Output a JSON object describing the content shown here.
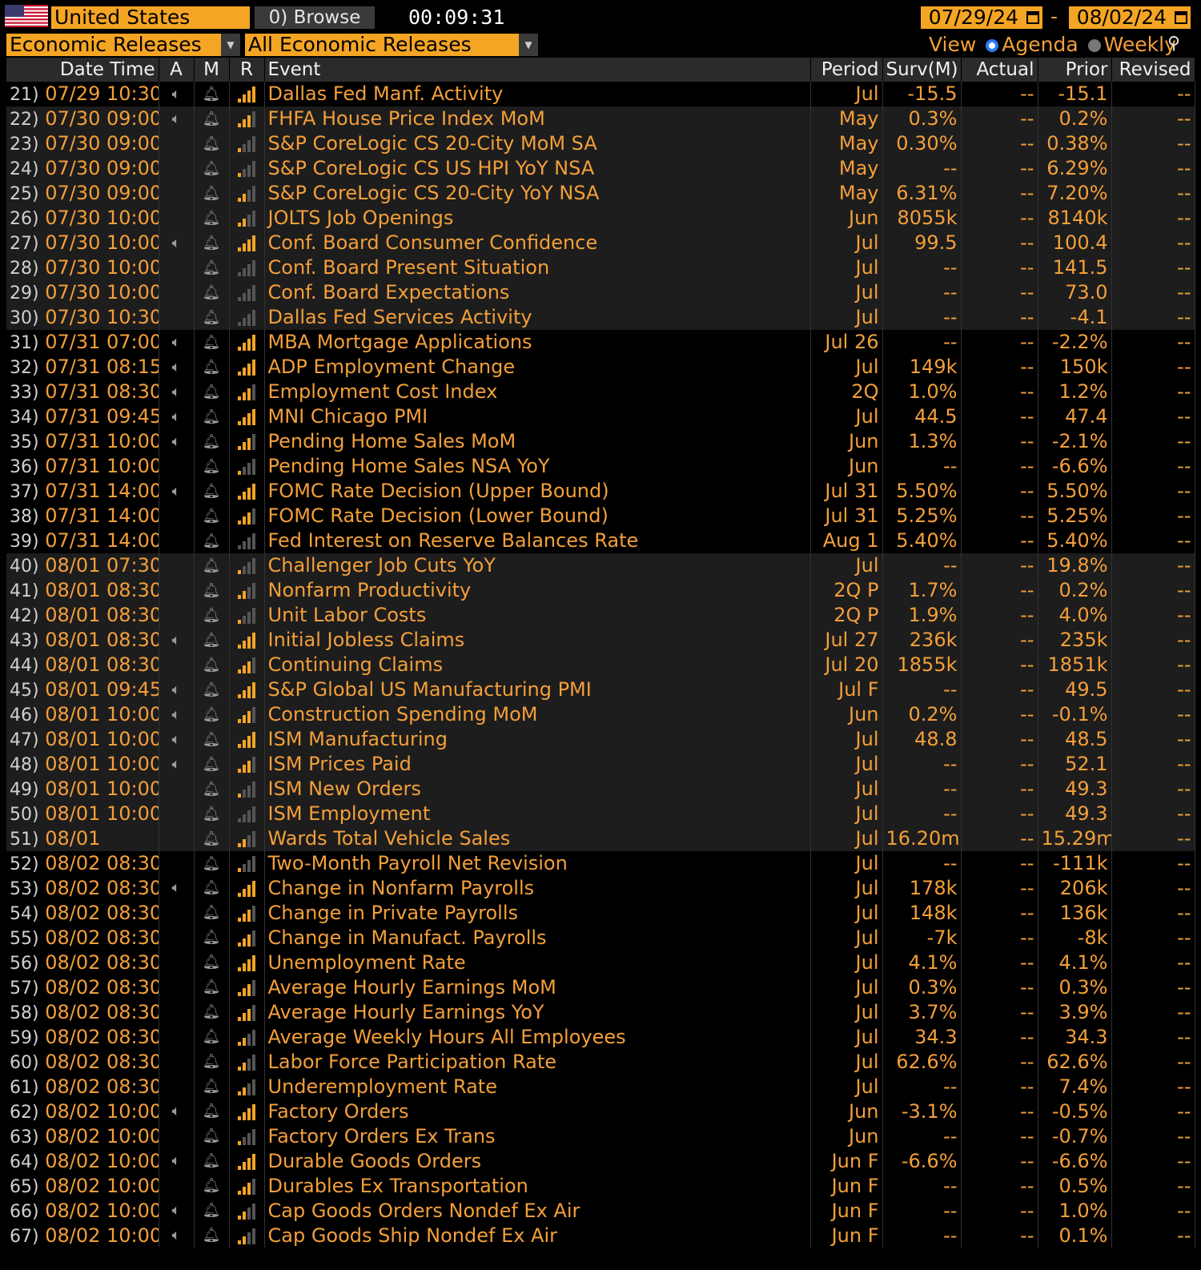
{
  "header": {
    "country": "United States",
    "browse_label": "Browse",
    "browse_prefix": "0",
    "clock": "00:09:31",
    "date_from": "07/29/24",
    "date_to": "08/02/24",
    "date_sep": "-",
    "filter1": "Economic Releases",
    "filter2": "All Economic Releases",
    "view_label": "View",
    "view_option1": "Agenda",
    "view_option2": "Weekly"
  },
  "columns": [
    "Date Time",
    "A",
    "M",
    "R",
    "Event",
    "Period",
    "Surv(M)",
    "Actual",
    "Prior",
    "Revised"
  ],
  "rows": [
    {
      "n": "21)",
      "dt": "07/29 10:30",
      "a": 1,
      "r": 4,
      "event": "Dallas Fed Manf. Activity",
      "period": "Jul",
      "surv": "-15.5",
      "actual": "--",
      "prior": "-15.1",
      "revised": "--",
      "shade": "blk"
    },
    {
      "n": "22)",
      "dt": "07/30 09:00",
      "a": 1,
      "r": 3,
      "event": "FHFA House Price Index MoM",
      "period": "May",
      "surv": "0.3%",
      "actual": "--",
      "prior": "0.2%",
      "revised": "--",
      "shade": "alt"
    },
    {
      "n": "23)",
      "dt": "07/30 09:00",
      "a": 0,
      "r": 1,
      "event": "S&P CoreLogic CS 20-City MoM SA",
      "period": "May",
      "surv": "0.30%",
      "actual": "--",
      "prior": "0.38%",
      "revised": "--",
      "shade": "alt"
    },
    {
      "n": "24)",
      "dt": "07/30 09:00",
      "a": 0,
      "r": 1,
      "event": "S&P CoreLogic CS US HPI YoY NSA",
      "period": "May",
      "surv": "--",
      "actual": "--",
      "prior": "6.29%",
      "revised": "--",
      "shade": "alt"
    },
    {
      "n": "25)",
      "dt": "07/30 09:00",
      "a": 0,
      "r": 2,
      "event": "S&P CoreLogic CS 20-City YoY NSA",
      "period": "May",
      "surv": "6.31%",
      "actual": "--",
      "prior": "7.20%",
      "revised": "--",
      "shade": "alt"
    },
    {
      "n": "26)",
      "dt": "07/30 10:00",
      "a": 0,
      "r": 2,
      "event": "JOLTS Job Openings",
      "period": "Jun",
      "surv": "8055k",
      "actual": "--",
      "prior": "8140k",
      "revised": "--",
      "shade": "alt"
    },
    {
      "n": "27)",
      "dt": "07/30 10:00",
      "a": 1,
      "r": 4,
      "event": "Conf. Board Consumer Confidence",
      "period": "Jul",
      "surv": "99.5",
      "actual": "--",
      "prior": "100.4",
      "revised": "--",
      "shade": "alt"
    },
    {
      "n": "28)",
      "dt": "07/30 10:00",
      "a": 0,
      "r": 0,
      "event": "Conf. Board Present Situation",
      "period": "Jul",
      "surv": "--",
      "actual": "--",
      "prior": "141.5",
      "revised": "--",
      "shade": "alt"
    },
    {
      "n": "29)",
      "dt": "07/30 10:00",
      "a": 0,
      "r": 0,
      "event": "Conf. Board Expectations",
      "period": "Jul",
      "surv": "--",
      "actual": "--",
      "prior": "73.0",
      "revised": "--",
      "shade": "alt"
    },
    {
      "n": "30)",
      "dt": "07/30 10:30",
      "a": 0,
      "r": 0,
      "event": "Dallas Fed Services Activity",
      "period": "Jul",
      "surv": "--",
      "actual": "--",
      "prior": "-4.1",
      "revised": "--",
      "shade": "alt"
    },
    {
      "n": "31)",
      "dt": "07/31 07:00",
      "a": 1,
      "r": 4,
      "event": "MBA Mortgage Applications",
      "period": "Jul 26",
      "surv": "--",
      "actual": "--",
      "prior": "-2.2%",
      "revised": "--",
      "shade": "blk"
    },
    {
      "n": "32)",
      "dt": "07/31 08:15",
      "a": 1,
      "r": 4,
      "event": "ADP Employment Change",
      "period": "Jul",
      "surv": "149k",
      "actual": "--",
      "prior": "150k",
      "revised": "--",
      "shade": "blk"
    },
    {
      "n": "33)",
      "dt": "07/31 08:30",
      "a": 1,
      "r": 3,
      "event": "Employment Cost Index",
      "period": "2Q",
      "surv": "1.0%",
      "actual": "--",
      "prior": "1.2%",
      "revised": "--",
      "shade": "blk"
    },
    {
      "n": "34)",
      "dt": "07/31 09:45",
      "a": 1,
      "r": 4,
      "event": "MNI Chicago PMI",
      "period": "Jul",
      "surv": "44.5",
      "actual": "--",
      "prior": "47.4",
      "revised": "--",
      "shade": "blk"
    },
    {
      "n": "35)",
      "dt": "07/31 10:00",
      "a": 1,
      "r": 3,
      "event": "Pending Home Sales MoM",
      "period": "Jun",
      "surv": "1.3%",
      "actual": "--",
      "prior": "-2.1%",
      "revised": "--",
      "shade": "blk"
    },
    {
      "n": "36)",
      "dt": "07/31 10:00",
      "a": 0,
      "r": 1,
      "event": "Pending Home Sales NSA YoY",
      "period": "Jun",
      "surv": "--",
      "actual": "--",
      "prior": "-6.6%",
      "revised": "--",
      "shade": "blk"
    },
    {
      "n": "37)",
      "dt": "07/31 14:00",
      "a": 1,
      "r": 4,
      "event": "FOMC Rate Decision (Upper Bound)",
      "period": "Jul 31",
      "surv": "5.50%",
      "actual": "--",
      "prior": "5.50%",
      "revised": "--",
      "shade": "blk"
    },
    {
      "n": "38)",
      "dt": "07/31 14:00",
      "a": 0,
      "r": 3,
      "event": "FOMC Rate Decision (Lower Bound)",
      "period": "Jul 31",
      "surv": "5.25%",
      "actual": "--",
      "prior": "5.25%",
      "revised": "--",
      "shade": "blk"
    },
    {
      "n": "39)",
      "dt": "07/31 14:00",
      "a": 0,
      "r": 0,
      "event": "Fed Interest on Reserve Balances Rate",
      "period": "Aug 1",
      "surv": "5.40%",
      "actual": "--",
      "prior": "5.40%",
      "revised": "--",
      "shade": "blk"
    },
    {
      "n": "40)",
      "dt": "08/01 07:30",
      "a": 0,
      "r": 1,
      "event": "Challenger Job Cuts YoY",
      "period": "Jul",
      "surv": "--",
      "actual": "--",
      "prior": "19.8%",
      "revised": "--",
      "shade": "alt"
    },
    {
      "n": "41)",
      "dt": "08/01 08:30",
      "a": 0,
      "r": 2,
      "event": "Nonfarm Productivity",
      "period": "2Q P",
      "surv": "1.7%",
      "actual": "--",
      "prior": "0.2%",
      "revised": "--",
      "shade": "alt"
    },
    {
      "n": "42)",
      "dt": "08/01 08:30",
      "a": 0,
      "r": 1,
      "event": "Unit Labor Costs",
      "period": "2Q P",
      "surv": "1.9%",
      "actual": "--",
      "prior": "4.0%",
      "revised": "--",
      "shade": "alt"
    },
    {
      "n": "43)",
      "dt": "08/01 08:30",
      "a": 1,
      "r": 4,
      "event": "Initial Jobless Claims",
      "period": "Jul 27",
      "surv": "236k",
      "actual": "--",
      "prior": "235k",
      "revised": "--",
      "shade": "alt"
    },
    {
      "n": "44)",
      "dt": "08/01 08:30",
      "a": 0,
      "r": 3,
      "event": "Continuing Claims",
      "period": "Jul 20",
      "surv": "1855k",
      "actual": "--",
      "prior": "1851k",
      "revised": "--",
      "shade": "alt"
    },
    {
      "n": "45)",
      "dt": "08/01 09:45",
      "a": 1,
      "r": 4,
      "event": "S&P Global US Manufacturing PMI",
      "period": "Jul F",
      "surv": "--",
      "actual": "--",
      "prior": "49.5",
      "revised": "--",
      "shade": "alt"
    },
    {
      "n": "46)",
      "dt": "08/01 10:00",
      "a": 1,
      "r": 3,
      "event": "Construction Spending MoM",
      "period": "Jun",
      "surv": "0.2%",
      "actual": "--",
      "prior": "-0.1%",
      "revised": "--",
      "shade": "alt"
    },
    {
      "n": "47)",
      "dt": "08/01 10:00",
      "a": 1,
      "r": 4,
      "event": "ISM Manufacturing",
      "period": "Jul",
      "surv": "48.8",
      "actual": "--",
      "prior": "48.5",
      "revised": "--",
      "shade": "alt"
    },
    {
      "n": "48)",
      "dt": "08/01 10:00",
      "a": 1,
      "r": 3,
      "event": "ISM Prices Paid",
      "period": "Jul",
      "surv": "--",
      "actual": "--",
      "prior": "52.1",
      "revised": "--",
      "shade": "alt"
    },
    {
      "n": "49)",
      "dt": "08/01 10:00",
      "a": 0,
      "r": 1,
      "event": "ISM New Orders",
      "period": "Jul",
      "surv": "--",
      "actual": "--",
      "prior": "49.3",
      "revised": "--",
      "shade": "alt"
    },
    {
      "n": "50)",
      "dt": "08/01 10:00",
      "a": 0,
      "r": 0,
      "event": "ISM Employment",
      "period": "Jul",
      "surv": "--",
      "actual": "--",
      "prior": "49.3",
      "revised": "--",
      "shade": "alt"
    },
    {
      "n": "51)",
      "dt": "08/01",
      "a": 0,
      "r": 2,
      "event": "Wards Total Vehicle Sales",
      "period": "Jul",
      "surv": "16.20m",
      "actual": "--",
      "prior": "15.29m",
      "revised": "--",
      "shade": "alt"
    },
    {
      "n": "52)",
      "dt": "08/02 08:30",
      "a": 0,
      "r": 1,
      "event": "Two-Month Payroll Net Revision",
      "period": "Jul",
      "surv": "--",
      "actual": "--",
      "prior": "-111k",
      "revised": "--",
      "shade": "blk"
    },
    {
      "n": "53)",
      "dt": "08/02 08:30",
      "a": 1,
      "r": 4,
      "event": "Change in Nonfarm Payrolls",
      "period": "Jul",
      "surv": "178k",
      "actual": "--",
      "prior": "206k",
      "revised": "--",
      "shade": "blk"
    },
    {
      "n": "54)",
      "dt": "08/02 08:30",
      "a": 0,
      "r": 3,
      "event": "Change in Private Payrolls",
      "period": "Jul",
      "surv": "148k",
      "actual": "--",
      "prior": "136k",
      "revised": "--",
      "shade": "blk"
    },
    {
      "n": "55)",
      "dt": "08/02 08:30",
      "a": 0,
      "r": 3,
      "event": "Change in Manufact. Payrolls",
      "period": "Jul",
      "surv": "-7k",
      "actual": "--",
      "prior": "-8k",
      "revised": "--",
      "shade": "blk"
    },
    {
      "n": "56)",
      "dt": "08/02 08:30",
      "a": 0,
      "r": 4,
      "event": "Unemployment Rate",
      "period": "Jul",
      "surv": "4.1%",
      "actual": "--",
      "prior": "4.1%",
      "revised": "--",
      "shade": "blk"
    },
    {
      "n": "57)",
      "dt": "08/02 08:30",
      "a": 0,
      "r": 3,
      "event": "Average Hourly Earnings MoM",
      "period": "Jul",
      "surv": "0.3%",
      "actual": "--",
      "prior": "0.3%",
      "revised": "--",
      "shade": "blk"
    },
    {
      "n": "58)",
      "dt": "08/02 08:30",
      "a": 0,
      "r": 3,
      "event": "Average Hourly Earnings YoY",
      "period": "Jul",
      "surv": "3.7%",
      "actual": "--",
      "prior": "3.9%",
      "revised": "--",
      "shade": "blk"
    },
    {
      "n": "59)",
      "dt": "08/02 08:30",
      "a": 0,
      "r": 2,
      "event": "Average Weekly Hours All Employees",
      "period": "Jul",
      "surv": "34.3",
      "actual": "--",
      "prior": "34.3",
      "revised": "--",
      "shade": "blk"
    },
    {
      "n": "60)",
      "dt": "08/02 08:30",
      "a": 0,
      "r": 2,
      "event": "Labor Force Participation Rate",
      "period": "Jul",
      "surv": "62.6%",
      "actual": "--",
      "prior": "62.6%",
      "revised": "--",
      "shade": "blk"
    },
    {
      "n": "61)",
      "dt": "08/02 08:30",
      "a": 0,
      "r": 2,
      "event": "Underemployment Rate",
      "period": "Jul",
      "surv": "--",
      "actual": "--",
      "prior": "7.4%",
      "revised": "--",
      "shade": "blk"
    },
    {
      "n": "62)",
      "dt": "08/02 10:00",
      "a": 1,
      "r": 4,
      "event": "Factory Orders",
      "period": "Jun",
      "surv": "-3.1%",
      "actual": "--",
      "prior": "-0.5%",
      "revised": "--",
      "shade": "blk"
    },
    {
      "n": "63)",
      "dt": "08/02 10:00",
      "a": 0,
      "r": 1,
      "event": "Factory Orders Ex Trans",
      "period": "Jun",
      "surv": "--",
      "actual": "--",
      "prior": "-0.7%",
      "revised": "--",
      "shade": "blk"
    },
    {
      "n": "64)",
      "dt": "08/02 10:00",
      "a": 1,
      "r": 4,
      "event": "Durable Goods Orders",
      "period": "Jun F",
      "surv": "-6.6%",
      "actual": "--",
      "prior": "-6.6%",
      "revised": "--",
      "shade": "blk"
    },
    {
      "n": "65)",
      "dt": "08/02 10:00",
      "a": 0,
      "r": 3,
      "event": "Durables Ex Transportation",
      "period": "Jun F",
      "surv": "--",
      "actual": "--",
      "prior": "0.5%",
      "revised": "--",
      "shade": "blk"
    },
    {
      "n": "66)",
      "dt": "08/02 10:00",
      "a": 1,
      "r": 2,
      "event": "Cap Goods Orders Nondef Ex Air",
      "period": "Jun F",
      "surv": "--",
      "actual": "--",
      "prior": "1.0%",
      "revised": "--",
      "shade": "blk"
    },
    {
      "n": "67)",
      "dt": "08/02 10:00",
      "a": 1,
      "r": 2,
      "event": "Cap Goods Ship Nondef Ex Air",
      "period": "Jun F",
      "surv": "--",
      "actual": "--",
      "prior": "0.1%",
      "revised": "--",
      "shade": "blk"
    }
  ],
  "icons": {
    "alert": "speaker-icon",
    "monitor": "bell-icon",
    "relevance": "relevance-bars-icon"
  },
  "colors": {
    "accent": "#f4a524",
    "text": "#f39f3a",
    "bg": "#000000",
    "alt_row": "#1d1d1d",
    "header": "#2b2b2b"
  }
}
